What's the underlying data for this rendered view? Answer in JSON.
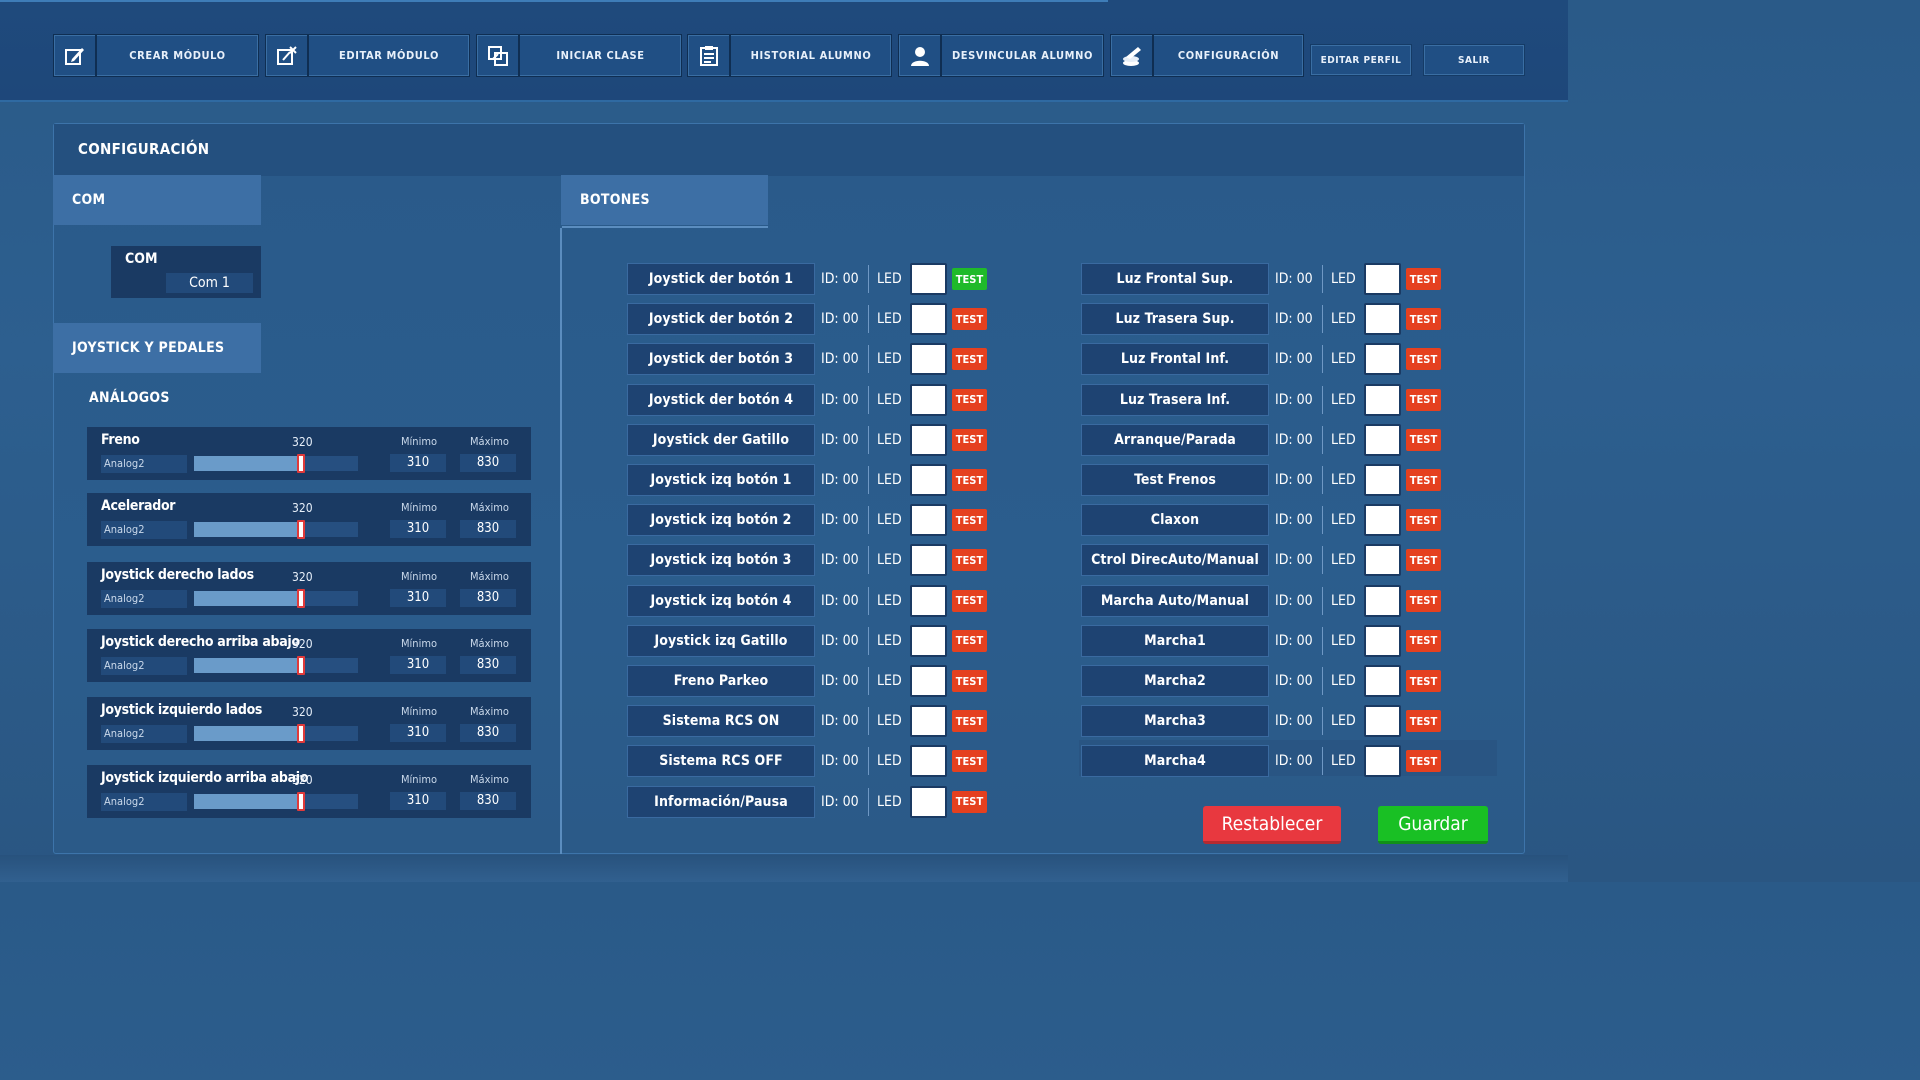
{
  "nav": {
    "buttons": [
      {
        "label": "CREAR MÓDULO",
        "icon": "edit-square-icon"
      },
      {
        "label": "EDITAR MÓDULO",
        "icon": "edit-x-icon"
      },
      {
        "label": "INICIAR CLASE",
        "icon": "swap-doc-icon"
      },
      {
        "label": "HISTORIAL ALUMNO",
        "icon": "clipboard-list-icon"
      },
      {
        "label": "DESVINCULAR ALUMNO",
        "icon": "user-icon"
      },
      {
        "label": "CONFIGURACIÓN",
        "icon": "wrench-coins-icon"
      }
    ],
    "edit_profile": "EDITAR PERFIL",
    "exit": "SALIR"
  },
  "panel": {
    "title": "CONFIGURACIÓN",
    "com_tab": "COM",
    "com_box": {
      "label": "COM",
      "value": "Com 1"
    },
    "joystick_tab": "JOYSTICK Y PEDALES",
    "analog_title": "ANÁLOGOS",
    "analogs": [
      {
        "name": "Freno",
        "source": "Analog2",
        "value": "320",
        "min_label": "Mínimo",
        "max_label": "Máximo",
        "min": "310",
        "max": "830",
        "level": 0.65
      },
      {
        "name": "Acelerador",
        "source": "Analog2",
        "value": "320",
        "min_label": "Mínimo",
        "max_label": "Máximo",
        "min": "310",
        "max": "830",
        "level": 0.65
      },
      {
        "name": "Joystick derecho lados",
        "source": "Analog2",
        "value": "320",
        "min_label": "Mínimo",
        "max_label": "Máximo",
        "min": "310",
        "max": "830",
        "level": 0.65
      },
      {
        "name": "Joystick derecho arriba abajo",
        "source": "Analog2",
        "value": "320",
        "min_label": "Mínimo",
        "max_label": "Máximo",
        "min": "310",
        "max": "830",
        "level": 0.65
      },
      {
        "name": "Joystick izquierdo lados",
        "source": "Analog2",
        "value": "320",
        "min_label": "Mínimo",
        "max_label": "Máximo",
        "min": "310",
        "max": "830",
        "level": 0.65
      },
      {
        "name": "Joystick izquierdo arriba abajo",
        "source": "Analog2",
        "value": "320",
        "min_label": "Mínimo",
        "max_label": "Máximo",
        "min": "310",
        "max": "830",
        "level": 0.65
      }
    ],
    "buttons_tab": "BOTONES",
    "buttons_left": [
      {
        "name": "Joystick der botón 1",
        "id": "ID: 00",
        "led": "LED",
        "test": "TEST",
        "test_ok": true
      },
      {
        "name": "Joystick der botón 2",
        "id": "ID: 00",
        "led": "LED",
        "test": "TEST",
        "test_ok": false
      },
      {
        "name": "Joystick der botón 3",
        "id": "ID: 00",
        "led": "LED",
        "test": "TEST",
        "test_ok": false
      },
      {
        "name": "Joystick der botón 4",
        "id": "ID: 00",
        "led": "LED",
        "test": "TEST",
        "test_ok": false
      },
      {
        "name": "Joystick der Gatillo",
        "id": "ID: 00",
        "led": "LED",
        "test": "TEST",
        "test_ok": false
      },
      {
        "name": "Joystick izq botón 1",
        "id": "ID: 00",
        "led": "LED",
        "test": "TEST",
        "test_ok": false
      },
      {
        "name": "Joystick izq botón 2",
        "id": "ID: 00",
        "led": "LED",
        "test": "TEST",
        "test_ok": false
      },
      {
        "name": "Joystick izq botón 3",
        "id": "ID: 00",
        "led": "LED",
        "test": "TEST",
        "test_ok": false
      },
      {
        "name": "Joystick izq botón 4",
        "id": "ID: 00",
        "led": "LED",
        "test": "TEST",
        "test_ok": false
      },
      {
        "name": "Joystick izq Gatillo",
        "id": "ID: 00",
        "led": "LED",
        "test": "TEST",
        "test_ok": false
      },
      {
        "name": "Freno Parkeo",
        "id": "ID: 00",
        "led": "LED",
        "test": "TEST",
        "test_ok": false
      },
      {
        "name": "Sistema RCS   ON",
        "id": "ID: 00",
        "led": "LED",
        "test": "TEST",
        "test_ok": false
      },
      {
        "name": "Sistema RCS   OFF",
        "id": "ID: 00",
        "led": "LED",
        "test": "TEST",
        "test_ok": false
      },
      {
        "name": "Información/Pausa",
        "id": "ID: 00",
        "led": "LED",
        "test": "TEST",
        "test_ok": false
      }
    ],
    "buttons_right": [
      {
        "name": "Luz Frontal Sup.",
        "id": "ID: 00",
        "led": "LED",
        "test": "TEST"
      },
      {
        "name": "Luz Trasera Sup.",
        "id": "ID: 00",
        "led": "LED",
        "test": "TEST"
      },
      {
        "name": "Luz Frontal Inf.",
        "id": "ID: 00",
        "led": "LED",
        "test": "TEST"
      },
      {
        "name": "Luz Trasera Inf.",
        "id": "ID: 00",
        "led": "LED",
        "test": "TEST"
      },
      {
        "name": "Arranque/Parada",
        "id": "ID: 00",
        "led": "LED",
        "test": "TEST"
      },
      {
        "name": "Test Frenos",
        "id": "ID: 00",
        "led": "LED",
        "test": "TEST"
      },
      {
        "name": "Claxon",
        "id": "ID: 00",
        "led": "LED",
        "test": "TEST"
      },
      {
        "name": "Ctrol DirecAuto/Manual",
        "id": "ID: 00",
        "led": "LED",
        "test": "TEST"
      },
      {
        "name": "Marcha Auto/Manual",
        "id": "ID: 00",
        "led": "LED",
        "test": "TEST"
      },
      {
        "name": "Marcha1",
        "id": "ID: 00",
        "led": "LED",
        "test": "TEST"
      },
      {
        "name": "Marcha2",
        "id": "ID: 00",
        "led": "LED",
        "test": "TEST"
      },
      {
        "name": "Marcha3",
        "id": "ID: 00",
        "led": "LED",
        "test": "TEST"
      },
      {
        "name": "Marcha4",
        "id": "ID: 00",
        "led": "LED",
        "test": "TEST"
      }
    ],
    "reset": "Restablecer",
    "save": "Guardar"
  },
  "colors": {
    "test_ok": "#1fba2a",
    "test_idle": "#e5401f",
    "reset": "#e8383f",
    "save": "#19c024"
  }
}
